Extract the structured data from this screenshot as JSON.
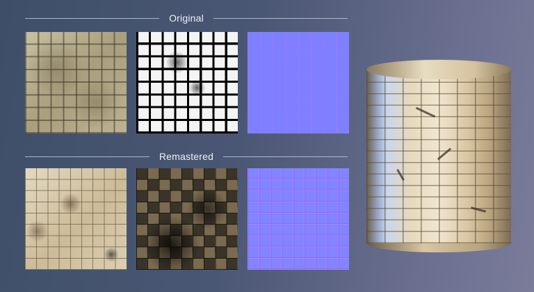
{
  "sections": {
    "original_title": "Original",
    "remastered_title": "Remastered"
  },
  "panels": [
    {
      "id": "original-albedo",
      "icon": "tile-texture-thumbnail"
    },
    {
      "id": "original-mask",
      "icon": "tile-mask-thumbnail"
    },
    {
      "id": "original-normal",
      "icon": "normal-map-thumbnail"
    },
    {
      "id": "remastered-albedo",
      "icon": "tile-texture-thumbnail"
    },
    {
      "id": "remastered-ao",
      "icon": "tile-ao-thumbnail"
    },
    {
      "id": "remastered-normal",
      "icon": "normal-map-thumbnail"
    }
  ],
  "preview": {
    "shape": "cylinder",
    "icon": "material-preview-cylinder"
  },
  "colors": {
    "background_left": "#3e4e68",
    "background_right": "#7b7c9a",
    "normal_map": "#7f80ff",
    "title_text": "#eef1f8"
  }
}
